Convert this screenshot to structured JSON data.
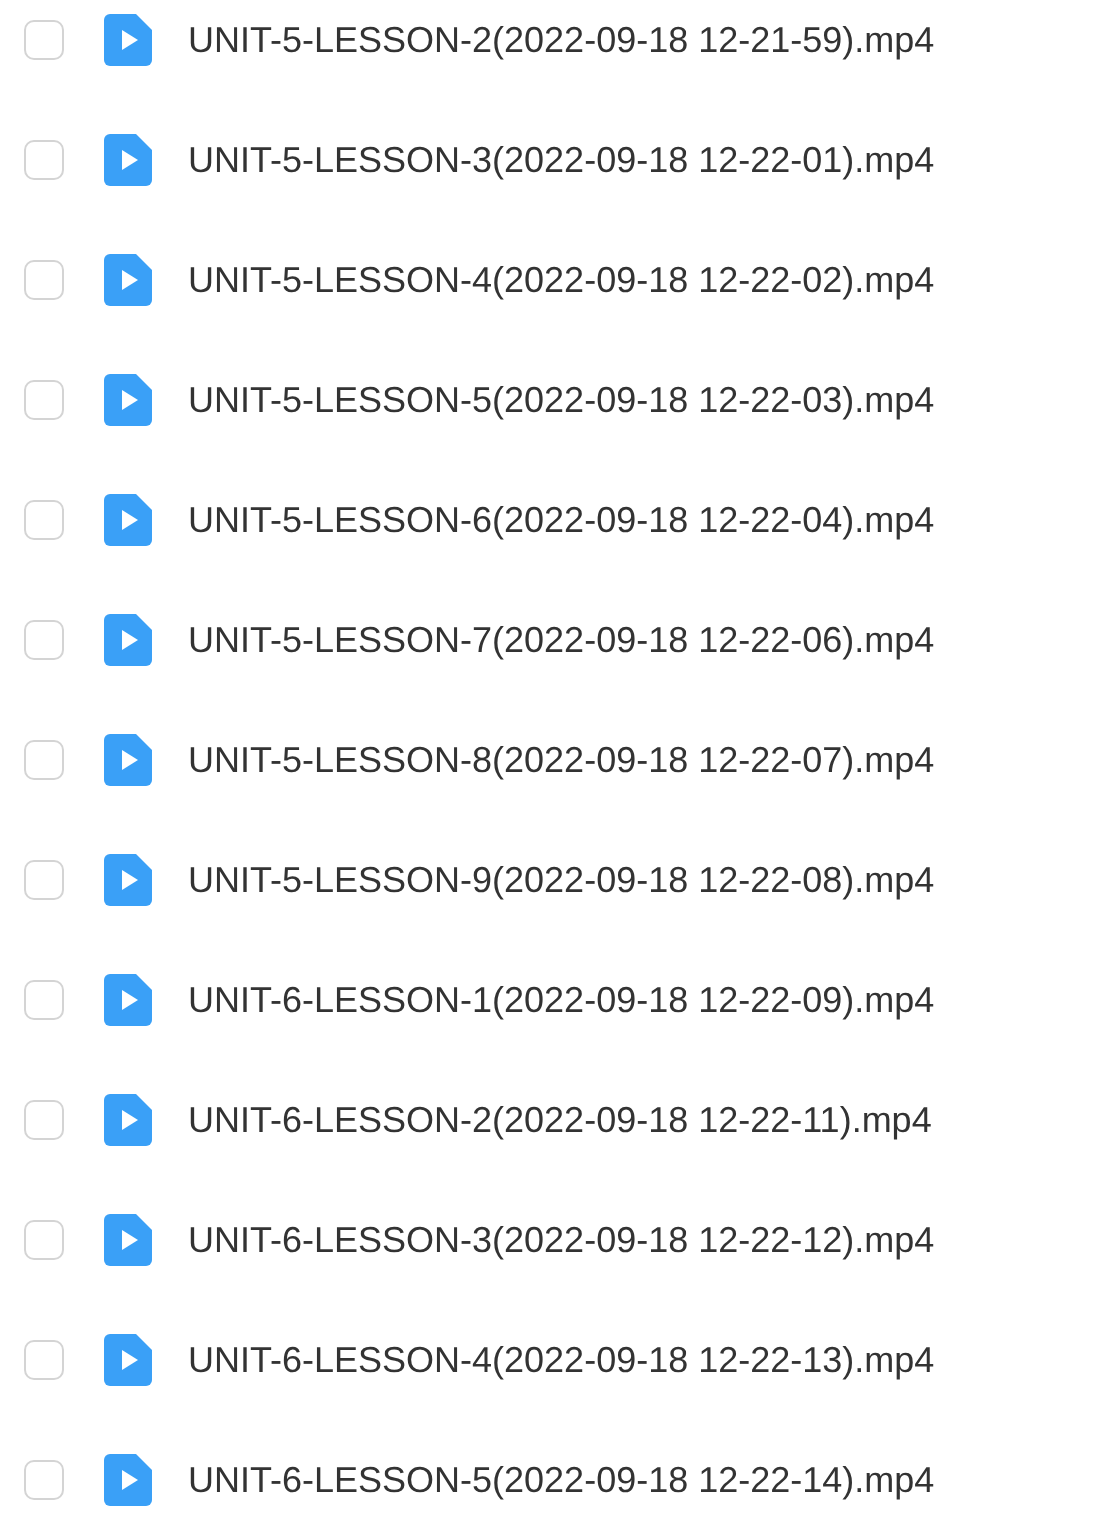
{
  "files": [
    {
      "name": "UNIT-5-LESSON-2(2022-09-18 12-21-59).mp4",
      "checked": false
    },
    {
      "name": "UNIT-5-LESSON-3(2022-09-18 12-22-01).mp4",
      "checked": false
    },
    {
      "name": "UNIT-5-LESSON-4(2022-09-18 12-22-02).mp4",
      "checked": false
    },
    {
      "name": "UNIT-5-LESSON-5(2022-09-18 12-22-03).mp4",
      "checked": false
    },
    {
      "name": "UNIT-5-LESSON-6(2022-09-18 12-22-04).mp4",
      "checked": false
    },
    {
      "name": "UNIT-5-LESSON-7(2022-09-18 12-22-06).mp4",
      "checked": false
    },
    {
      "name": "UNIT-5-LESSON-8(2022-09-18 12-22-07).mp4",
      "checked": false
    },
    {
      "name": "UNIT-5-LESSON-9(2022-09-18 12-22-08).mp4",
      "checked": false
    },
    {
      "name": "UNIT-6-LESSON-1(2022-09-18 12-22-09).mp4",
      "checked": false
    },
    {
      "name": "UNIT-6-LESSON-2(2022-09-18 12-22-11).mp4",
      "checked": false
    },
    {
      "name": "UNIT-6-LESSON-3(2022-09-18 12-22-12).mp4",
      "checked": false
    },
    {
      "name": "UNIT-6-LESSON-4(2022-09-18 12-22-13).mp4",
      "checked": false
    },
    {
      "name": "UNIT-6-LESSON-5(2022-09-18 12-22-14).mp4",
      "checked": false
    }
  ]
}
